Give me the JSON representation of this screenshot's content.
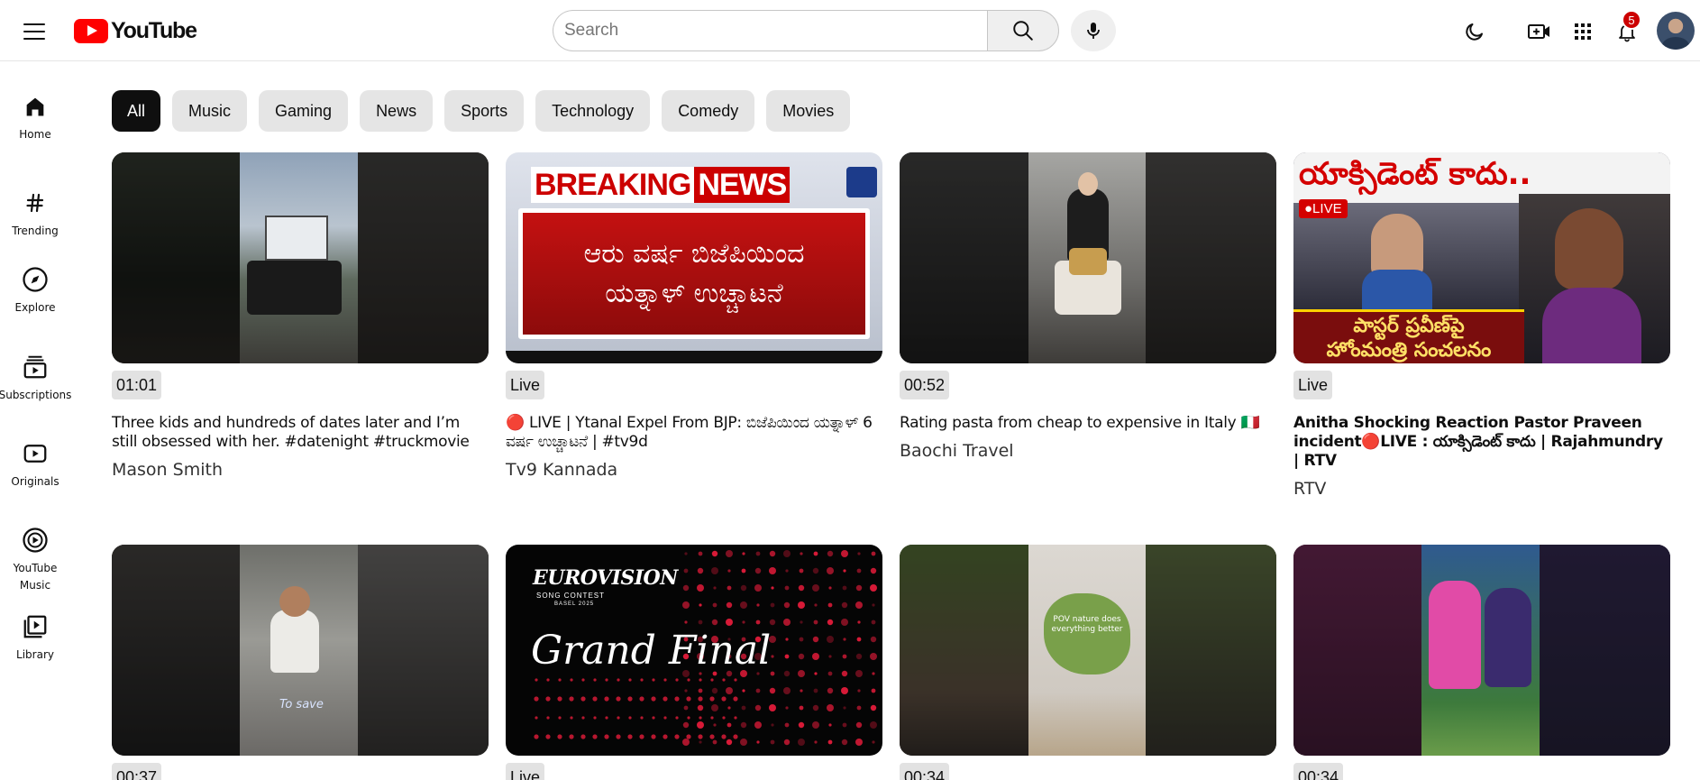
{
  "app": {
    "logo_text": "YouTube",
    "search_placeholder": "Search",
    "notification_count": "5"
  },
  "colors": {
    "brand_red": "#ff0000",
    "chip_active_bg": "#0f0f0f",
    "chip_bg": "#e5e5e5",
    "badge_red": "#cc0000"
  },
  "sidebar": {
    "items": [
      {
        "label": "Home",
        "icon": "home-icon"
      },
      {
        "label": "Trending",
        "icon": "hash-icon"
      },
      {
        "label": "Explore",
        "icon": "compass-icon"
      },
      {
        "label": "Subscriptions",
        "icon": "subscriptions-icon"
      },
      {
        "label": "Originals",
        "icon": "originals-icon"
      },
      {
        "label": "YouTube Music",
        "icon": "music-play-icon"
      },
      {
        "label": "Library",
        "icon": "library-icon"
      }
    ]
  },
  "chips": [
    "All",
    "Music",
    "Gaming",
    "News",
    "Sports",
    "Technology",
    "Comedy",
    "Movies"
  ],
  "videos": [
    {
      "badge": "01:01",
      "title": "Three kids and hundreds of dates later and I’m still obsessed with her. #datenight #truckmovie",
      "channel": "Mason Smith"
    },
    {
      "badge": "Live",
      "title": "🔴 LIVE | Ytanal Expel From BJP: ಬಿಜೆಪಿಯಿಂದ ಯತ್ನಾಳ್ 6 ವರ್ಷ ಉಚ್ಚಾಟನೆ | #tv9d",
      "channel": "Tv9 Kannada",
      "thumb_text": {
        "top_a": "BREAKING",
        "top_b": "NEWS",
        "line1": "ಆರು ವರ್ಷ ಬಿಜೆಪಿಯಿಂದ",
        "line2": "ಯತ್ನಾಳ್ ಉಚ್ಚಾಟನೆ"
      }
    },
    {
      "badge": "00:52",
      "title": "Rating pasta from cheap to expensive in Italy 🇮🇹",
      "channel": "Baochi Travel"
    },
    {
      "badge": "Live",
      "title": "Anitha Shocking Reaction Pastor Praveen incident🔴LIVE : యాక్సిడెంట్ కాదు | Rajahmundry | RTV",
      "channel": "RTV",
      "thumb_text": {
        "headline": "యాక్సిడెంట్ కాదు..",
        "live": "●LIVE",
        "bottom1": "పాస్టర్ ప్రవీణ్‌పై",
        "bottom2": "హోంమంత్రి సంచలనం"
      }
    },
    {
      "badge": "00:37",
      "title": "",
      "channel": "",
      "thumb_text": {
        "caption": "To save"
      }
    },
    {
      "badge": "Live",
      "title": "",
      "channel": "",
      "thumb_text": {
        "brand": "EUROVISION",
        "sub": "SONG CONTEST",
        "sub2": "BASEL 2025",
        "headline": "Grand Final"
      }
    },
    {
      "badge": "00:34",
      "title": "",
      "channel": "",
      "thumb_text": {
        "overlay": "POV nature does everything better"
      }
    },
    {
      "badge": "00:34",
      "title": "",
      "channel": ""
    }
  ]
}
